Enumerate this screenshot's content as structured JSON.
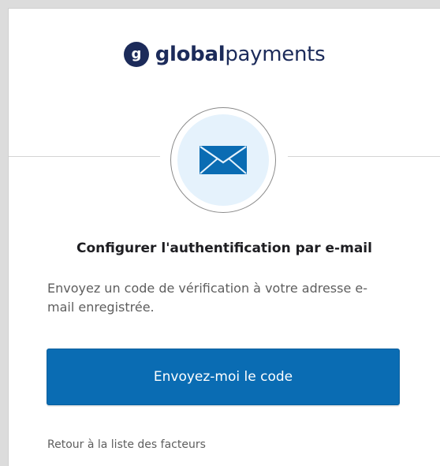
{
  "brand": {
    "name_bold": "global",
    "name_regular": "payments",
    "logo_letter": "g",
    "color": "#1c2b5a"
  },
  "factor": {
    "icon": "envelope-icon",
    "beacon_bg": "#e5f2fc",
    "icon_color": "#0a6cb3"
  },
  "content": {
    "title": "Configurer l'authentification par e-mail",
    "description": "Envoyez un code de vérification à votre adresse e-mail enregistrée."
  },
  "actions": {
    "send_code_label": "Envoyez-moi le code",
    "back_link_label": "Retour à la liste des facteurs",
    "primary_color": "#0a6cb3"
  }
}
